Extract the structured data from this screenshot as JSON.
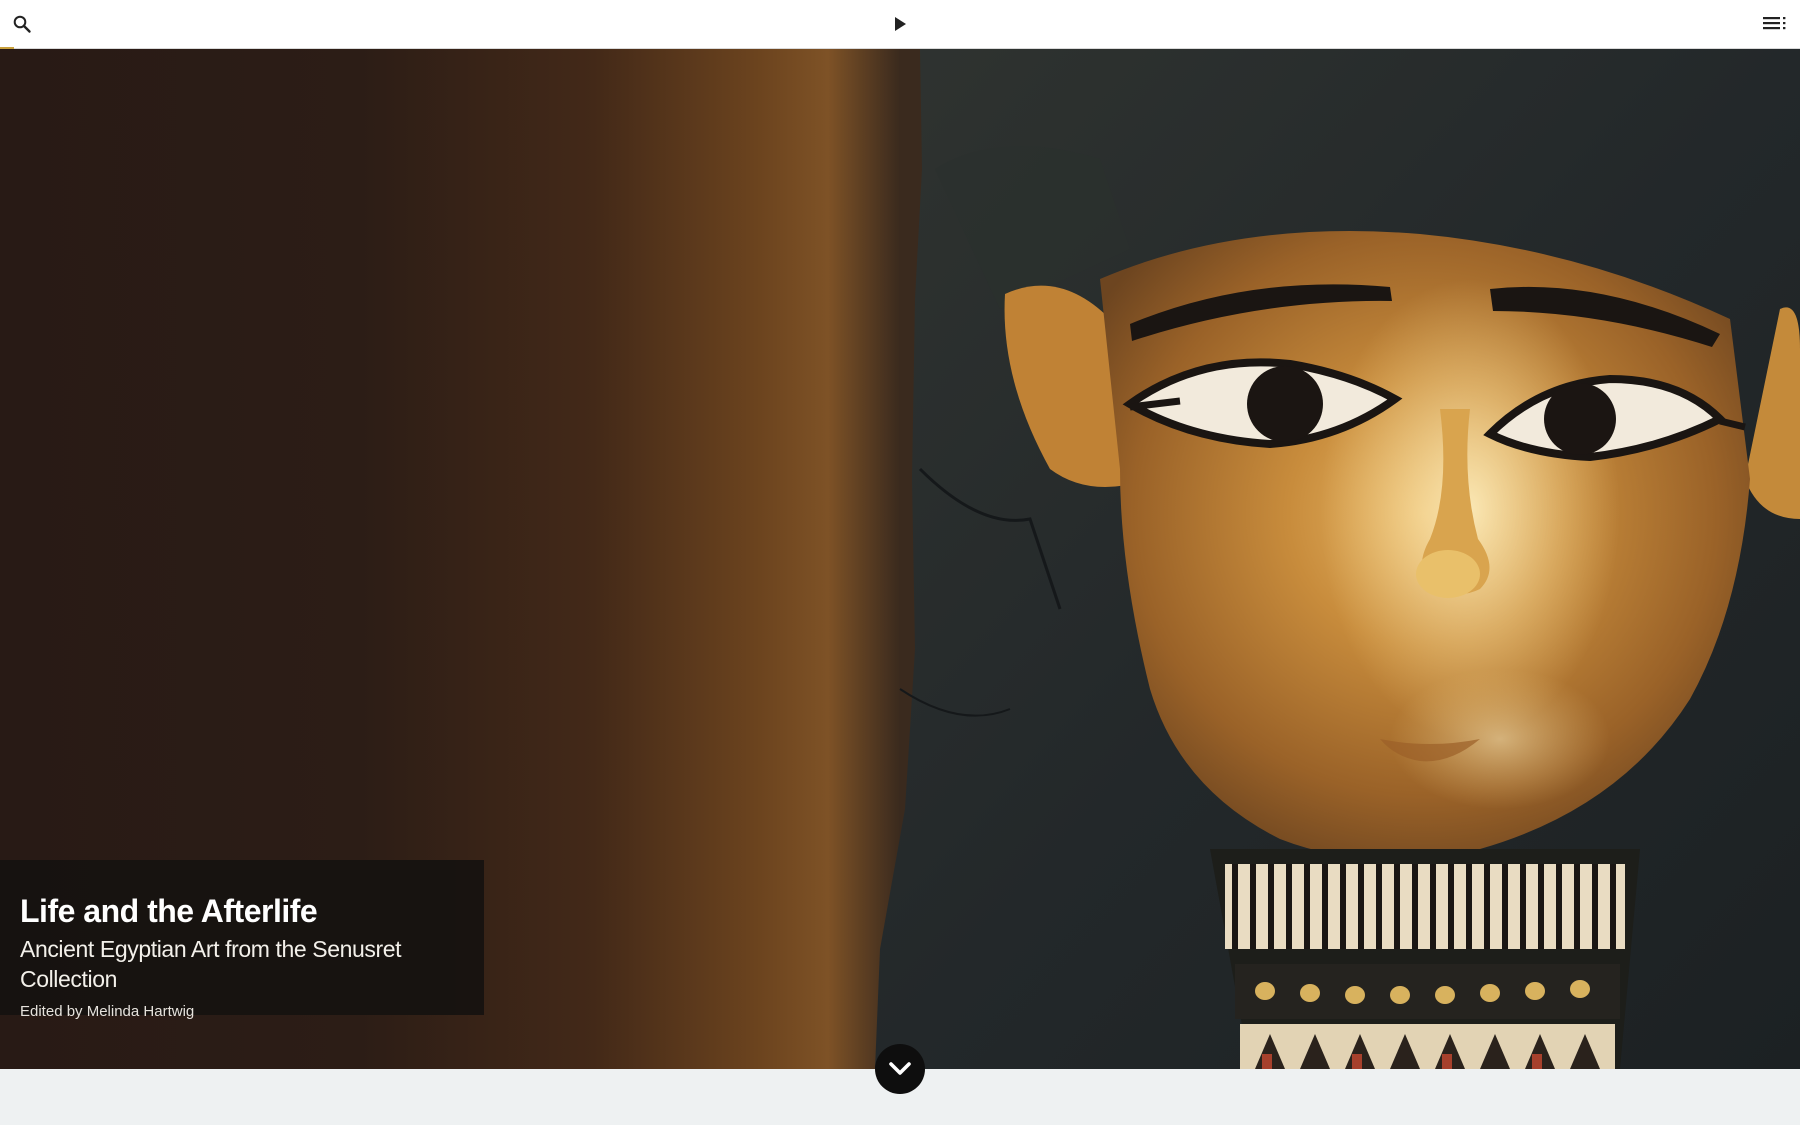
{
  "toolbar": {
    "search_icon": "search-icon",
    "play_icon": "play-icon",
    "toc_icon": "table-of-contents-icon",
    "progress_fraction": 0.008,
    "accent_color": "#c9a03b"
  },
  "hero": {
    "image": "Gilded Egyptian mummy mask with painted eyes and collar",
    "title": "Life and the Afterlife",
    "subtitle": "Ancient Egyptian Art from the Senusret Collection",
    "editor": "Edited by Melinda Hartwig"
  },
  "scroll_button": {
    "icon": "chevron-down-icon"
  },
  "colors": {
    "topbar_bg": "#ffffff",
    "hero_bg": "#2a1c16",
    "title_card_bg": "#161210",
    "footer_bg": "#eef1f2",
    "scroll_button_bg": "#0e0e0e",
    "gold": "#c89a3c"
  }
}
